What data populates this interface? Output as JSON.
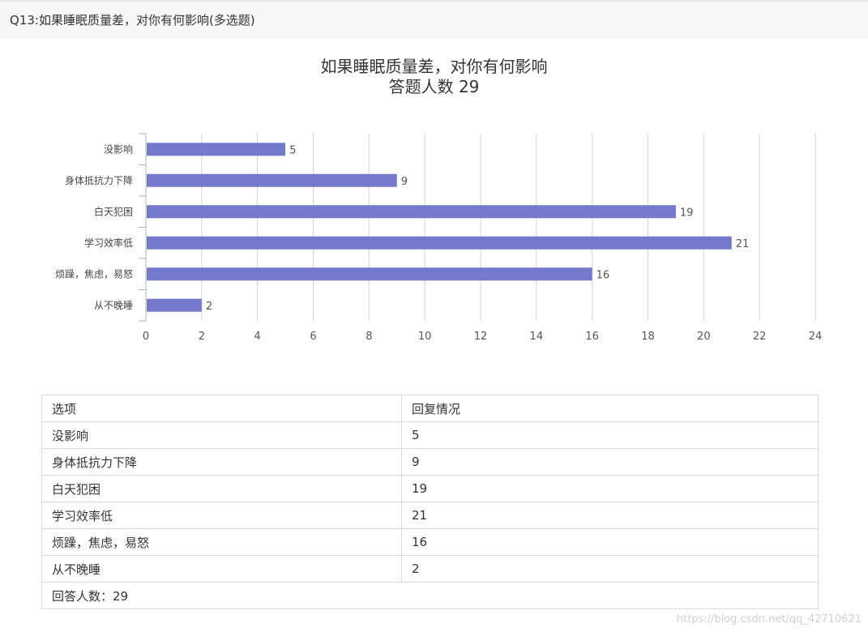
{
  "question": {
    "title": "Q13:如果睡眠质量差，对你有何影响(多选题)"
  },
  "chart_data": {
    "type": "bar",
    "orientation": "horizontal",
    "title": "如果睡眠质量差，对你有何影响",
    "subtitle": "答题人数 29",
    "categories": [
      "没影响",
      "身体抵抗力下降",
      "白天犯困",
      "学习效率低",
      "烦躁，焦虑，易怒",
      "从不晚睡"
    ],
    "values": [
      5,
      9,
      19,
      21,
      16,
      2
    ],
    "xlim": [
      0,
      24
    ],
    "xticks": [
      0,
      2,
      4,
      6,
      8,
      10,
      12,
      14,
      16,
      18,
      20,
      22,
      24
    ],
    "grid": true,
    "data_labels": true,
    "bar_color": "#7479cc"
  },
  "table": {
    "headers": [
      "选项",
      "回复情况"
    ],
    "rows": [
      [
        "没影响",
        "5"
      ],
      [
        "身体抵抗力下降",
        "9"
      ],
      [
        "白天犯困",
        "19"
      ],
      [
        "学习效率低",
        "21"
      ],
      [
        "烦躁，焦虑，易怒",
        "16"
      ],
      [
        "从不晚睡",
        "2"
      ]
    ],
    "footer": "回答人数：29"
  },
  "watermark": "https://blog.csdn.net/qq_42710621"
}
